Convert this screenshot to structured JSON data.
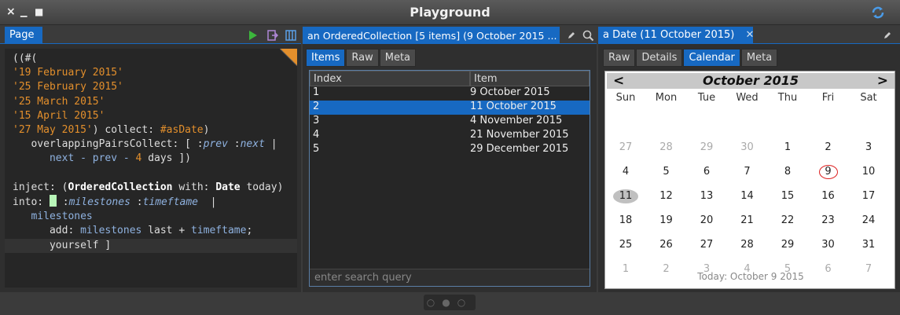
{
  "window": {
    "title": "Playground",
    "close_glyph": "×",
    "minimize_glyph": "▁",
    "maximize_glyph": "■"
  },
  "pane1": {
    "tab_label": "Page",
    "code_lines": [
      [
        {
          "t": "((#(",
          "c": "def"
        }
      ],
      [
        {
          "t": "'19 February 2015'",
          "c": "str"
        }
      ],
      [
        {
          "t": "'25 February 2015'",
          "c": "str"
        }
      ],
      [
        {
          "t": "'25 March 2015'",
          "c": "str"
        }
      ],
      [
        {
          "t": "'15 April 2015'",
          "c": "str"
        }
      ],
      [
        {
          "t": "'27 May 2015'",
          "c": "str"
        },
        {
          "t": ") collect: ",
          "c": "def"
        },
        {
          "t": "#asDate",
          "c": "sym"
        },
        {
          "t": ")",
          "c": "def"
        }
      ],
      [
        {
          "t": "   overlappingPairsCollect: [ :",
          "c": "def"
        },
        {
          "t": "prev",
          "c": "var"
        },
        {
          "t": " :",
          "c": "def"
        },
        {
          "t": "next",
          "c": "var"
        },
        {
          "t": " |",
          "c": "def"
        }
      ],
      [
        {
          "t": "      next - prev - ",
          "c": "blue"
        },
        {
          "t": "4",
          "c": "num"
        },
        {
          "t": " days ])",
          "c": "def"
        }
      ],
      [
        {
          "t": "",
          "c": "def"
        }
      ],
      [
        {
          "t": "inject: (",
          "c": "def"
        },
        {
          "t": "OrderedCollection",
          "c": "kw"
        },
        {
          "t": " with: ",
          "c": "def"
        },
        {
          "t": "Date",
          "c": "kw"
        },
        {
          "t": " today)",
          "c": "def"
        }
      ],
      [
        {
          "t": "into: ",
          "c": "def"
        },
        {
          "t": "CURSOR",
          "c": "cursor"
        },
        {
          "t": " :",
          "c": "def"
        },
        {
          "t": "milestones",
          "c": "var"
        },
        {
          "t": " :",
          "c": "def"
        },
        {
          "t": "timeftame",
          "c": "var"
        },
        {
          "t": "  |",
          "c": "def"
        }
      ],
      [
        {
          "t": "   milestones",
          "c": "blue"
        }
      ],
      [
        {
          "t": "      add: ",
          "c": "def"
        },
        {
          "t": "milestones",
          "c": "blue"
        },
        {
          "t": " last + ",
          "c": "def"
        },
        {
          "t": "timeftame",
          "c": "blue"
        },
        {
          "t": ";",
          "c": "def"
        }
      ],
      [
        {
          "t": "      yourself ]",
          "c": "def"
        }
      ]
    ]
  },
  "pane2": {
    "tab_label": "an OrderedCollection [5 items] (9 October 2015  ...",
    "subtabs": [
      "Items",
      "Raw",
      "Meta"
    ],
    "active_subtab": 0,
    "columns": [
      "Index",
      "Item"
    ],
    "rows": [
      {
        "index": "1",
        "item": "9 October 2015"
      },
      {
        "index": "2",
        "item": "11 October 2015"
      },
      {
        "index": "3",
        "item": "4 November 2015"
      },
      {
        "index": "4",
        "item": "21 November 2015"
      },
      {
        "index": "5",
        "item": "29 December 2015"
      }
    ],
    "selected_row": 1,
    "search_placeholder": "enter search query"
  },
  "pane3": {
    "tab_label": "a Date (11 October 2015)",
    "close_glyph": "✕",
    "subtabs": [
      "Raw",
      "Details",
      "Calendar",
      "Meta"
    ],
    "active_subtab": 2,
    "calendar": {
      "month_title": "October 2015",
      "prev_glyph": "<",
      "next_glyph": ">",
      "weekdays": [
        "Sun",
        "Mon",
        "Tue",
        "Wed",
        "Thu",
        "Fri",
        "Sat"
      ],
      "weeks": [
        [
          "27",
          "28",
          "29",
          "30",
          "1",
          "2",
          "3"
        ],
        [
          "4",
          "5",
          "6",
          "7",
          "8",
          "9",
          "10"
        ],
        [
          "11",
          "12",
          "13",
          "14",
          "15",
          "16",
          "17"
        ],
        [
          "18",
          "19",
          "20",
          "21",
          "22",
          "23",
          "24"
        ],
        [
          "25",
          "26",
          "27",
          "28",
          "29",
          "30",
          "31"
        ],
        [
          "1",
          "2",
          "3",
          "4",
          "5",
          "6",
          "7"
        ]
      ],
      "today_label": "Today: October 9 2015"
    }
  },
  "pager_dots": "○●○",
  "colors": {
    "accent": "#1769c2",
    "string": "#e38f2c"
  }
}
